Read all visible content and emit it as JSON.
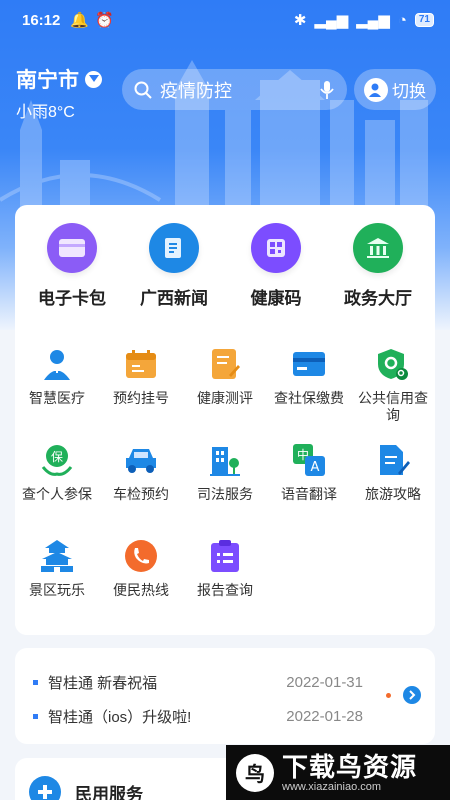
{
  "status": {
    "time": "16:12",
    "battery": "71"
  },
  "location": {
    "city": "南宁市",
    "weather": "小雨8°C"
  },
  "search": {
    "placeholder": "疫情防控"
  },
  "switch_label": "切换",
  "quick_actions": [
    {
      "label": "电子卡包",
      "icon": "card-wallet-icon",
      "color": "#8b5cf6"
    },
    {
      "label": "广西新闻",
      "icon": "news-icon",
      "color": "#1e88e5"
    },
    {
      "label": "健康码",
      "icon": "qrcode-icon",
      "color": "#7c4dff"
    },
    {
      "label": "政务大厅",
      "icon": "government-hall-icon",
      "color": "#20b05a"
    }
  ],
  "services": [
    {
      "label": "智慧医疗",
      "icon": "doctor-icon"
    },
    {
      "label": "预约挂号",
      "icon": "calendar-icon"
    },
    {
      "label": "健康测评",
      "icon": "health-check-icon"
    },
    {
      "label": "查社保缴费",
      "icon": "social-security-card-icon"
    },
    {
      "label": "公共信用查询",
      "icon": "credit-shield-icon"
    },
    {
      "label": "查个人参保",
      "icon": "insurance-icon"
    },
    {
      "label": "车检预约",
      "icon": "car-icon"
    },
    {
      "label": "司法服务",
      "icon": "justice-building-icon"
    },
    {
      "label": "语音翻译",
      "icon": "translate-icon"
    },
    {
      "label": "旅游攻略",
      "icon": "travel-guide-icon"
    },
    {
      "label": "景区玩乐",
      "icon": "pagoda-icon"
    },
    {
      "label": "便民热线",
      "icon": "phone-hotline-icon"
    },
    {
      "label": "报告查询",
      "icon": "report-icon"
    }
  ],
  "news": [
    {
      "title": "智桂通  新春祝福",
      "date": "2022-01-31"
    },
    {
      "title": "智桂通（ios）升级啦!",
      "date": "2022-01-28"
    }
  ],
  "civil_service": {
    "title": "民用服务"
  },
  "watermark": {
    "brand": "下载鸟资源",
    "url": "www.xiazainiao.com",
    "logo": "鸟"
  }
}
